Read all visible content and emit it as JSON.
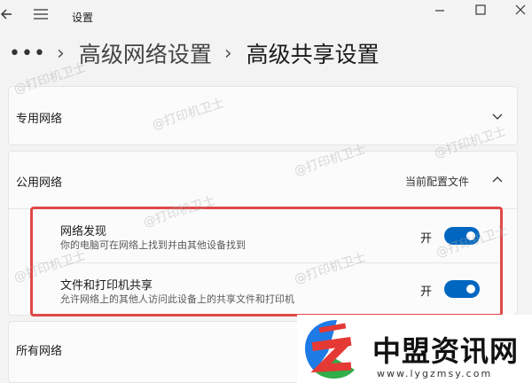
{
  "window": {
    "title": "设置"
  },
  "breadcrumb": {
    "more": "•••",
    "sep": "›",
    "parent": "高级网络设置",
    "current": "高级共享设置"
  },
  "sections": {
    "private": {
      "label": "专用网络"
    },
    "public": {
      "label": "公用网络",
      "status": "当前配置文件"
    },
    "all": {
      "label": "所有网络"
    }
  },
  "settings": {
    "discovery": {
      "title": "网络发现",
      "desc": "你的电脑可在网络上找到并由其他设备找到",
      "state": "开",
      "on": true
    },
    "sharing": {
      "title": "文件和打印机共享",
      "desc": "允许网络上的其他人访问此设备上的共享文件和打印机",
      "state": "开",
      "on": true
    }
  },
  "watermark": {
    "text": "@打印机卫士"
  },
  "logo": {
    "name": "中盟资讯网",
    "url": "www.lygzmsy.com"
  },
  "colors": {
    "accent": "#0067c0",
    "highlight": "#e04848"
  }
}
